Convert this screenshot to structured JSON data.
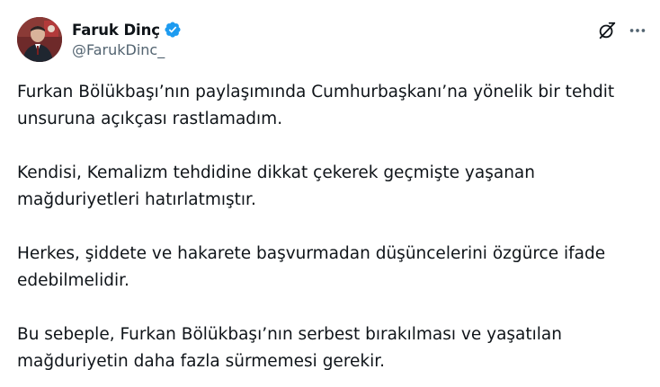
{
  "author": {
    "display_name": "Faruk Dinç",
    "handle": "@FarukDinc_",
    "verified": true,
    "verified_color": "#1d9bf0"
  },
  "actions": {
    "grok_icon": "grok-icon",
    "more_icon": "more-icon"
  },
  "tweet": {
    "paragraphs": [
      "Furkan Bölükbaşı’nın paylaşımında Cumhurbaşkanı’na yönelik bir tehdit\nunsuruna açıkçası rastlamadım.",
      "Kendisi, Kemalizm tehdidine dikkat çekerek geçmişte yaşanan\nmağduriyetleri hatırlatmıştır.",
      "Herkes, şiddete ve hakarete başvurmadan düşüncelerini özgürce ifade\nedebilmelidir.",
      "Bu sebeple, Furkan Bölükbaşı’nın serbest bırakılması ve yaşatılan\nmağduriyetin daha fazla sürmemesi gerekir."
    ]
  }
}
